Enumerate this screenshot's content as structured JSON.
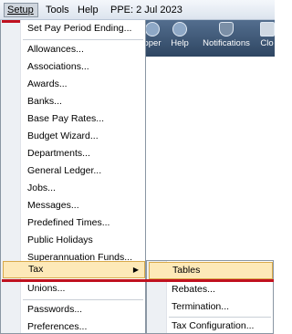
{
  "menubar": {
    "setup": "Setup",
    "tools": "Tools",
    "help": "Help",
    "ppe": "PPE:  2 Jul 2023"
  },
  "toolbar": {
    "items": [
      "oper",
      "Help",
      "Notifications",
      "Clo"
    ]
  },
  "setup_menu": {
    "items": [
      "Set Pay Period Ending...",
      "Allowances...",
      "Associations...",
      "Awards...",
      "Banks...",
      "Base Pay Rates...",
      "Budget Wizard...",
      "Departments...",
      "General Ledger...",
      "Jobs...",
      "Messages...",
      "Predefined Times...",
      "Public Holidays",
      "Superannuation Funds...",
      "Tax",
      "Unions...",
      "Passwords...",
      "Preferences..."
    ]
  },
  "tax_submenu": {
    "items": [
      "Tables",
      "Rebates...",
      "Termination...",
      "Tax Configuration..."
    ]
  },
  "colors": {
    "highlight": "#fde9b8",
    "highlight_border": "#d8a94a",
    "accent_red": "#c0111f"
  }
}
